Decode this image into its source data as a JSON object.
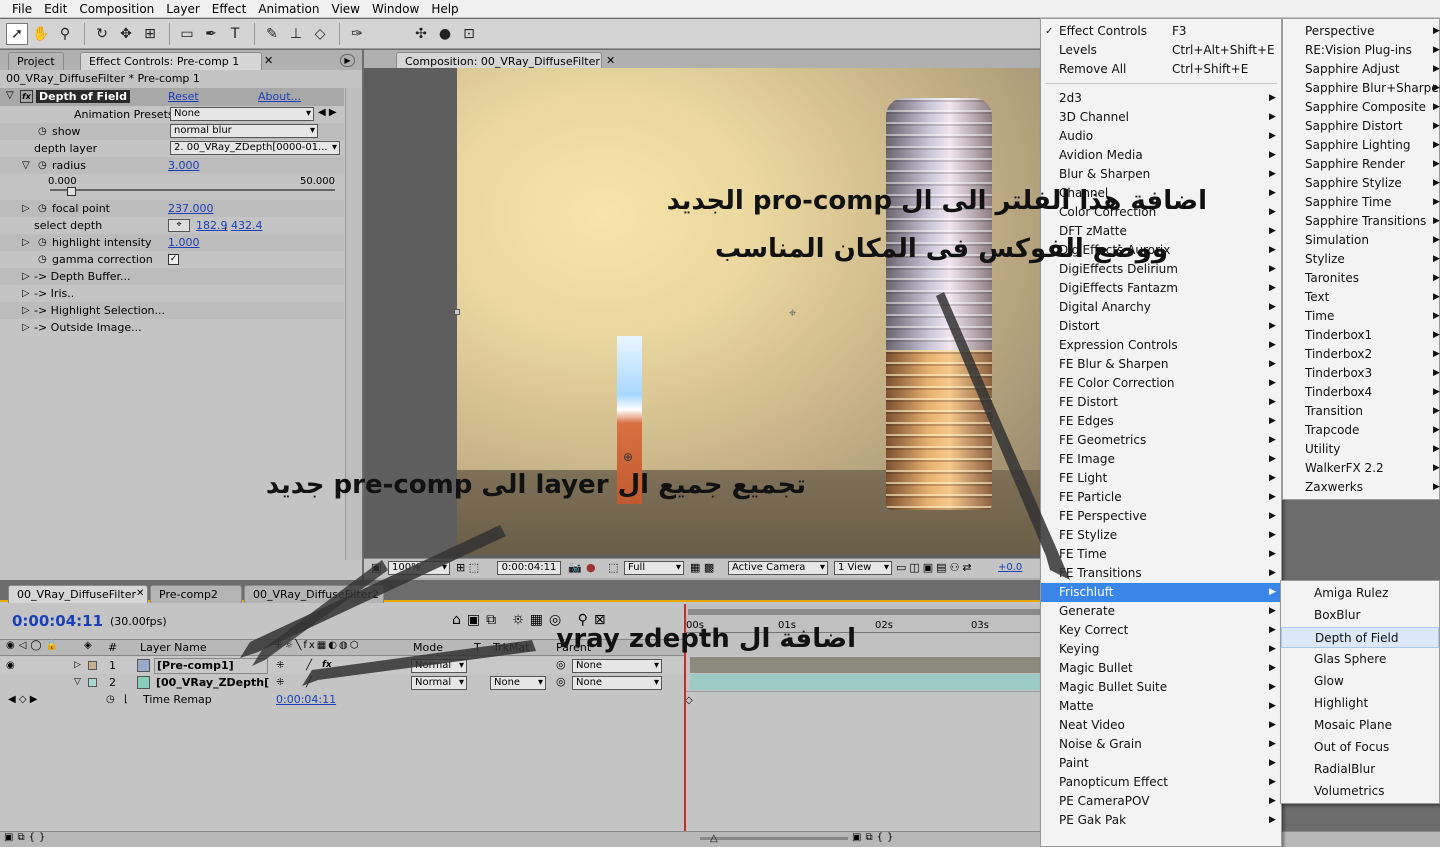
{
  "menubar": [
    "File",
    "Edit",
    "Composition",
    "Layer",
    "Effect",
    "Animation",
    "View",
    "Window",
    "Help"
  ],
  "tabs": {
    "project": "Project",
    "effect_controls": "Effect Controls: Pre-comp 1",
    "composition": "Composition: 00_VRay_DiffuseFilter",
    "timeline_tabs": [
      "00_VRay_DiffuseFilter",
      "Pre-comp2",
      "00_VRay_DiffuseFilter2"
    ]
  },
  "effect_panel": {
    "breadcrumb": "00_VRay_DiffuseFilter * Pre-comp 1",
    "effect_name": "Depth of Field",
    "reset": "Reset",
    "about": "About...",
    "presets_label": "Animation Presets:",
    "presets_value": "None",
    "props": {
      "show_label": "show",
      "show_value": "normal blur",
      "depth_layer_label": "depth layer",
      "depth_layer_value": "2. 00_VRay_ZDepth[0000-01...",
      "radius_label": "radius",
      "radius_value": "3.000",
      "slider_min": "0.000",
      "slider_max": "50.000",
      "focal_label": "focal point",
      "focal_value": "237.000",
      "select_depth_label": "select depth",
      "select_depth_x": "182.9",
      "select_depth_y": "432.4",
      "highlight_label": "highlight intensity",
      "highlight_value": "1.000",
      "gamma_label": "gamma correction",
      "groups": [
        "-> Depth Buffer...",
        "-> Iris..",
        "-> Highlight Selection...",
        "-> Outside Image..."
      ]
    }
  },
  "viewer_bar": {
    "zoom": "100%",
    "timecode": "0:00:04:11",
    "resolution": "Full",
    "camera": "Active Camera",
    "views": "1 View",
    "exposure": "+0.0"
  },
  "timeline": {
    "timecode": "0:00:04:11",
    "fps": "(30.00fps)",
    "headers": {
      "num": "#",
      "layer_name": "Layer Name",
      "mode": "Mode",
      "t": "T",
      "trkmat": "TrkMat",
      "parent": "Parent"
    },
    "ruler": [
      "00s",
      "01s",
      "02s",
      "03s"
    ],
    "layers": [
      {
        "num": "1",
        "name": "[Pre-comp1]",
        "mode": "Normal",
        "trkmat": "",
        "parent": "None"
      },
      {
        "num": "2",
        "name": "[00_VRay_ZDepth[",
        "mode": "Normal",
        "trkmat": "None",
        "parent": "None"
      }
    ],
    "time_remap_label": "Time Remap",
    "time_remap_value": "0:00:04:11"
  },
  "menu_effect": {
    "top": [
      {
        "label": "Effect Controls",
        "shortcut": "F3",
        "checked": true
      },
      {
        "label": "Levels",
        "shortcut": "Ctrl+Alt+Shift+E"
      },
      {
        "label": "Remove All",
        "shortcut": "Ctrl+Shift+E"
      }
    ],
    "categories": [
      "2d3",
      "3D Channel",
      "Audio",
      "Avidion Media",
      "Blur & Sharpen",
      "Channel",
      "Color Correction",
      "DFT zMatte",
      "DigiEffects Aurorix",
      "DigiEffects Delirium",
      "DigiEffects Fantazm",
      "Digital Anarchy",
      "Distort",
      "Expression Controls",
      "FE Blur & Sharpen",
      "FE Color Correction",
      "FE Distort",
      "FE Edges",
      "FE Geometrics",
      "FE Image",
      "FE Light",
      "FE Particle",
      "FE Perspective",
      "FE Stylize",
      "FE Time",
      "FE Transitions",
      "Frischluft",
      "Generate",
      "Key Correct",
      "Keying",
      "Magic Bullet",
      "Magic Bullet Suite",
      "Matte",
      "Neat Video",
      "Noise & Grain",
      "Paint",
      "Panopticum Effect",
      "PE CameraPOV",
      "PE Gak Pak"
    ],
    "highlighted": "Frischluft"
  },
  "menu_more": [
    "Perspective",
    "RE:Vision Plug-ins",
    "Sapphire Adjust",
    "Sapphire Blur+Sharpen",
    "Sapphire Composite",
    "Sapphire Distort",
    "Sapphire Lighting",
    "Sapphire Render",
    "Sapphire Stylize",
    "Sapphire Time",
    "Sapphire Transitions",
    "Simulation",
    "Stylize",
    "Taronites",
    "Text",
    "Time",
    "Tinderbox1",
    "Tinderbox2",
    "Tinderbox3",
    "Tinderbox4",
    "Transition",
    "Trapcode",
    "Utility",
    "WalkerFX 2.2",
    "Zaxwerks"
  ],
  "menu_frischluft": {
    "items": [
      "Amiga Rulez",
      "BoxBlur",
      "Depth of Field",
      "Glas Sphere",
      "Glow",
      "Highlight",
      "Mosaic Plane",
      "Out of Focus",
      "RadialBlur",
      "Volumetrics"
    ],
    "highlighted": "Depth of Field"
  },
  "annotations": {
    "a1": "اضافة هذا الفلتر الى ال pro-comp الجديد",
    "a2": "ووضع الفوكس فى المكان المناسب",
    "a3": "تجميع جميع ال layer الى pre-comp جديد",
    "a4": "اضافة ال vray zdepth"
  }
}
